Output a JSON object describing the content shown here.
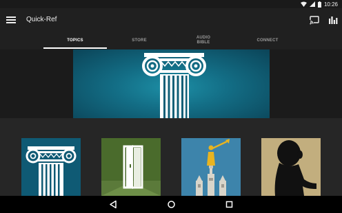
{
  "status_bar": {
    "time": "10:26",
    "icons": [
      "wifi-icon",
      "signal-icon",
      "battery-icon"
    ]
  },
  "app_bar": {
    "title": "Quick-Ref",
    "icons": [
      "menu-icon",
      "cast-icon",
      "equalizer-icon"
    ]
  },
  "tabs": [
    {
      "label": "TOPICS",
      "active": true
    },
    {
      "label": "STORE",
      "active": false
    },
    {
      "label": "AUDIO BIBLE",
      "active": false
    },
    {
      "label": "CONNECT",
      "active": false
    }
  ],
  "hero": {
    "image": "ionic-column-banner"
  },
  "tiles": [
    {
      "image": "ionic-column-tile",
      "background": "#0f5a74"
    },
    {
      "image": "open-door-tile",
      "background": "#4a6b2c"
    },
    {
      "image": "angel-trumpet-temple-tile",
      "background": "#3a7fa6"
    },
    {
      "image": "child-silhouette-tile",
      "background": "#c2ae7e"
    }
  ],
  "nav_bar": {
    "icons": [
      "back-icon",
      "home-icon",
      "recents-icon"
    ]
  },
  "colors": {
    "accent": "#ffffff",
    "app_bar": "#202020",
    "background": "#222222",
    "inactive_tab": "#9a9a9a"
  }
}
